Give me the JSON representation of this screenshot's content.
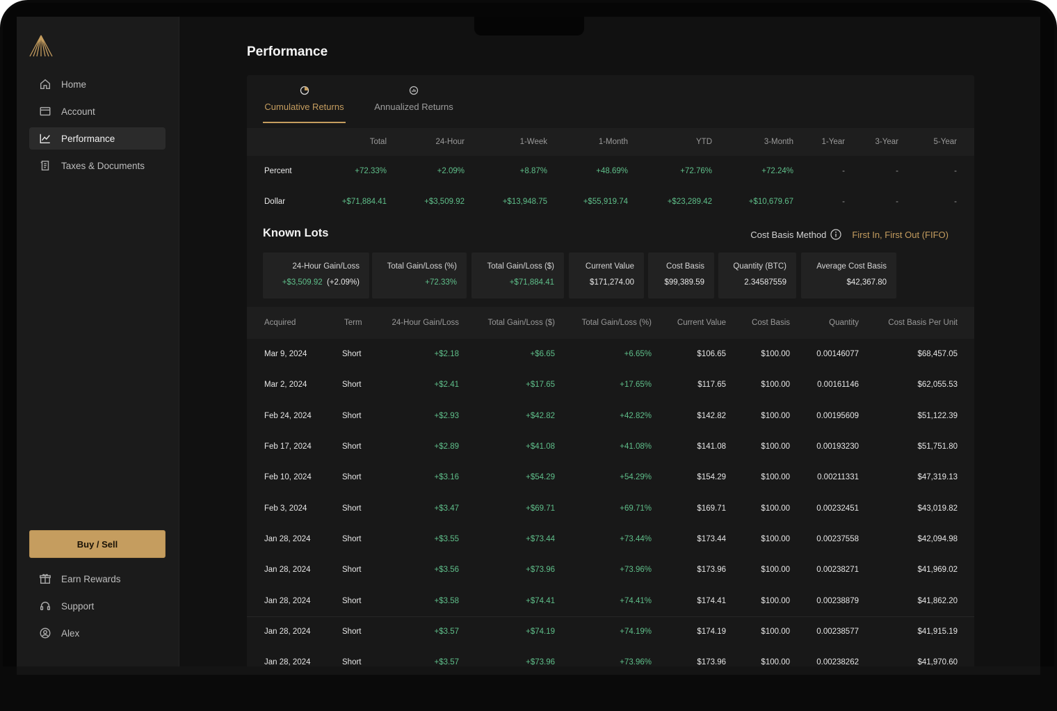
{
  "sidebar": {
    "nav": [
      {
        "label": "Home",
        "icon": "home-icon"
      },
      {
        "label": "Account",
        "icon": "wallet-icon"
      },
      {
        "label": "Performance",
        "icon": "chart-line-icon",
        "active": true
      },
      {
        "label": "Taxes & Documents",
        "icon": "document-icon"
      }
    ],
    "buy_sell": "Buy / Sell",
    "bottom": [
      {
        "label": "Earn Rewards",
        "icon": "gift-icon"
      },
      {
        "label": "Support",
        "icon": "headset-icon"
      },
      {
        "label": "Alex",
        "icon": "user-circle-icon"
      }
    ]
  },
  "page": {
    "title": "Performance",
    "tabs": [
      {
        "label": "Cumulative Returns",
        "icon": "pie-chart-icon",
        "active": true
      },
      {
        "label": "Annualized Returns",
        "icon": "bar-chart-icon",
        "active": false
      }
    ]
  },
  "returns": {
    "columns": [
      "Total",
      "24-Hour",
      "1-Week",
      "1-Month",
      "YTD",
      "3-Month",
      "1-Year",
      "3-Year",
      "5-Year"
    ],
    "rows": [
      {
        "label": "Percent",
        "values": [
          "+72.33%",
          "+2.09%",
          "+8.87%",
          "+48.69%",
          "+72.76%",
          "+72.24%",
          "-",
          "-",
          "-"
        ]
      },
      {
        "label": "Dollar",
        "values": [
          "+$71,884.41",
          "+$3,509.92",
          "+$13,948.75",
          "+$55,919.74",
          "+$23,289.42",
          "+$10,679.67",
          "-",
          "-",
          "-"
        ]
      }
    ]
  },
  "known_lots": {
    "title": "Known Lots",
    "cost_basis_label": "Cost Basis Method",
    "cost_basis_value": "First In, First Out (FIFO)",
    "stats": [
      {
        "label": "24-Hour Gain/Loss",
        "value_green": "+$3,509.92",
        "value_white": "(+2.09%)"
      },
      {
        "label": "Total Gain/Loss (%)",
        "value_green": "+72.33%",
        "value_white": ""
      },
      {
        "label": "Total Gain/Loss ($)",
        "value_green": "+$71,884.41",
        "value_white": ""
      },
      {
        "label": "Current Value",
        "value_green": "",
        "value_white": "$171,274.00"
      },
      {
        "label": "Cost Basis",
        "value_green": "",
        "value_white": "$99,389.59"
      },
      {
        "label": "Quantity (BTC)",
        "value_green": "",
        "value_white": "2.34587559"
      },
      {
        "label": "Average Cost Basis",
        "value_green": "",
        "value_white": "$42,367.80"
      }
    ],
    "columns": [
      "Acquired",
      "Term",
      "24-Hour Gain/Loss",
      "Total Gain/Loss ($)",
      "Total Gain/Loss (%)",
      "Current Value",
      "Cost Basis",
      "Quantity",
      "Cost Basis Per Unit"
    ],
    "rows": [
      [
        "Mar 9, 2024",
        "Short",
        "+$2.18",
        "+$6.65",
        "+6.65%",
        "$106.65",
        "$100.00",
        "0.00146077",
        "$68,457.05"
      ],
      [
        "Mar 2, 2024",
        "Short",
        "+$2.41",
        "+$17.65",
        "+17.65%",
        "$117.65",
        "$100.00",
        "0.00161146",
        "$62,055.53"
      ],
      [
        "Feb 24, 2024",
        "Short",
        "+$2.93",
        "+$42.82",
        "+42.82%",
        "$142.82",
        "$100.00",
        "0.00195609",
        "$51,122.39"
      ],
      [
        "Feb 17, 2024",
        "Short",
        "+$2.89",
        "+$41.08",
        "+41.08%",
        "$141.08",
        "$100.00",
        "0.00193230",
        "$51,751.80"
      ],
      [
        "Feb 10, 2024",
        "Short",
        "+$3.16",
        "+$54.29",
        "+54.29%",
        "$154.29",
        "$100.00",
        "0.00211331",
        "$47,319.13"
      ],
      [
        "Feb 3, 2024",
        "Short",
        "+$3.47",
        "+$69.71",
        "+69.71%",
        "$169.71",
        "$100.00",
        "0.00232451",
        "$43,019.82"
      ],
      [
        "Jan 28, 2024",
        "Short",
        "+$3.55",
        "+$73.44",
        "+73.44%",
        "$173.44",
        "$100.00",
        "0.00237558",
        "$42,094.98"
      ],
      [
        "Jan 28, 2024",
        "Short",
        "+$3.56",
        "+$73.96",
        "+73.96%",
        "$173.96",
        "$100.00",
        "0.00238271",
        "$41,969.02"
      ],
      [
        "Jan 28, 2024",
        "Short",
        "+$3.58",
        "+$74.41",
        "+74.41%",
        "$174.41",
        "$100.00",
        "0.00238879",
        "$41,862.20"
      ],
      [
        "Jan 28, 2024",
        "Short",
        "+$3.57",
        "+$74.19",
        "+74.19%",
        "$174.19",
        "$100.00",
        "0.00238577",
        "$41,915.19"
      ],
      [
        "Jan 28, 2024",
        "Short",
        "+$3.57",
        "+$73.96",
        "+73.96%",
        "$173.96",
        "$100.00",
        "0.00238262",
        "$41,970.60"
      ]
    ]
  },
  "colors": {
    "accent": "#c59d5f",
    "positive": "#5fbf8a",
    "background": "#111111"
  }
}
